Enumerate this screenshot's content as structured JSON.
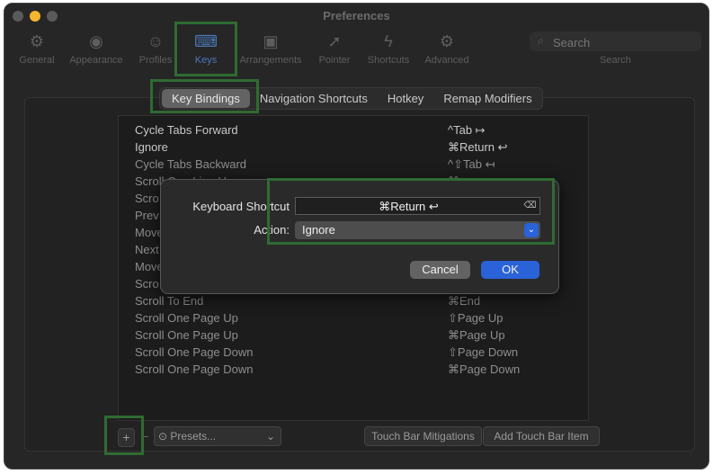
{
  "window": {
    "title": "Preferences"
  },
  "toolbar": {
    "items": [
      {
        "label": "General",
        "icon": "gear-icon"
      },
      {
        "label": "Appearance",
        "icon": "eye-icon"
      },
      {
        "label": "Profiles",
        "icon": "person-icon"
      },
      {
        "label": "Keys",
        "icon": "keyboard-icon"
      },
      {
        "label": "Arrangements",
        "icon": "windows-icon"
      },
      {
        "label": "Pointer",
        "icon": "cursor-icon"
      },
      {
        "label": "Shortcuts",
        "icon": "bolt-icon"
      },
      {
        "label": "Advanced",
        "icon": "gears-icon"
      }
    ],
    "active": "Keys",
    "search": {
      "placeholder": "Search",
      "caption": "Search"
    }
  },
  "tabs": [
    "Key Bindings",
    "Navigation Shortcuts",
    "Hotkey",
    "Remap Modifiers"
  ],
  "selected_tab": "Key Bindings",
  "bindings": [
    {
      "action": "Cycle Tabs Forward",
      "shortcut": "^Tab ↦"
    },
    {
      "action": "Ignore",
      "shortcut": "⌘Return ↩"
    },
    {
      "action": "Cycle Tabs Backward",
      "shortcut": "^⇧Tab ↤"
    },
    {
      "action": "Scroll One Line Up",
      "shortcut": "⌘↑"
    },
    {
      "action": "Scro",
      "shortcut": ""
    },
    {
      "action": "Prev",
      "shortcut": ""
    },
    {
      "action": "Move",
      "shortcut": ""
    },
    {
      "action": "Next",
      "shortcut": ""
    },
    {
      "action": "Move",
      "shortcut": ""
    },
    {
      "action": "Scro",
      "shortcut": ""
    },
    {
      "action": "Scroll To End",
      "shortcut": "⌘End"
    },
    {
      "action": "Scroll One Page Up",
      "shortcut": "⇧Page Up"
    },
    {
      "action": "Scroll One Page Up",
      "shortcut": "⌘Page Up"
    },
    {
      "action": "Scroll One Page Down",
      "shortcut": "⇧Page Down"
    },
    {
      "action": "Scroll One Page Down",
      "shortcut": "⌘Page Down"
    }
  ],
  "bottom": {
    "add": "+",
    "remove": "−",
    "presets": "Presets...",
    "touch_bar_mitigations": "Touch Bar Mitigations",
    "add_touch_bar_item": "Add Touch Bar Item"
  },
  "dialog": {
    "shortcut_label": "Keyboard Shortcut",
    "shortcut_value": "⌘Return ↩",
    "action_label": "Action:",
    "action_value": "Ignore",
    "cancel": "Cancel",
    "ok": "OK"
  },
  "colors": {
    "accent": "#2a62d8",
    "highlight_box": "#2f6b33"
  }
}
